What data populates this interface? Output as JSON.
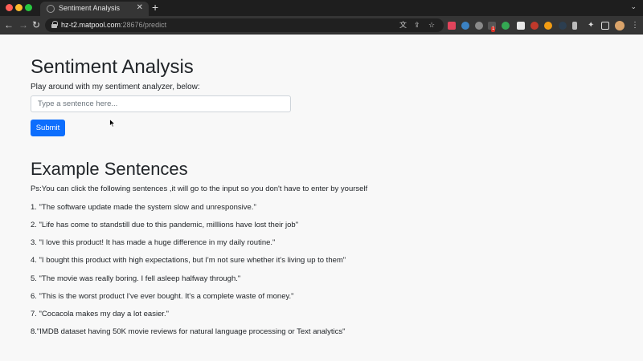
{
  "browser": {
    "tab_title": "Sentiment Analysis",
    "tab_close": "✕",
    "new_tab": "+",
    "url_host": "hz-t2.matpool.com",
    "url_rest": ":28676/predict",
    "nav": {
      "back": "←",
      "forward": "→",
      "reload": "↻"
    },
    "omnibox_icons": [
      "translate-icon",
      "share-icon",
      "star-icon"
    ],
    "extension_badge": "1"
  },
  "page": {
    "title": "Sentiment Analysis",
    "lead": "Play around with my sentiment analyzer, below:",
    "input": {
      "value": "",
      "placeholder": "Type a sentence here..."
    },
    "submit_label": "Submit",
    "examples_title": "Example Sentences",
    "ps_note": "Ps:You can click the following sentences ,it will go to the input so you don't have to enter by yourself",
    "examples": [
      "1. \"The software update made the system slow and unresponsive.\"",
      "2. \"Life has come to standstill due to this pandemic, milllions have lost their job\"",
      "3. \"I love this product! It has made a huge difference in my daily routine.\"",
      "4. \"I bought this product with high expectations, but I'm not sure whether it's living up to them\"",
      "5. \"The movie was really boring. I fell asleep halfway through.\"",
      "6. \"This is the worst product I've ever bought. It's a complete waste of money.\"",
      "7. \"Cocacola makes my day a lot easier.\"",
      "8.\"IMDB dataset having 50K movie reviews for natural language processing or Text analytics\""
    ]
  },
  "colors": {
    "primary_button": "#0d6efd",
    "page_background": "#f8f8f8",
    "browser_chrome": "#353535"
  }
}
